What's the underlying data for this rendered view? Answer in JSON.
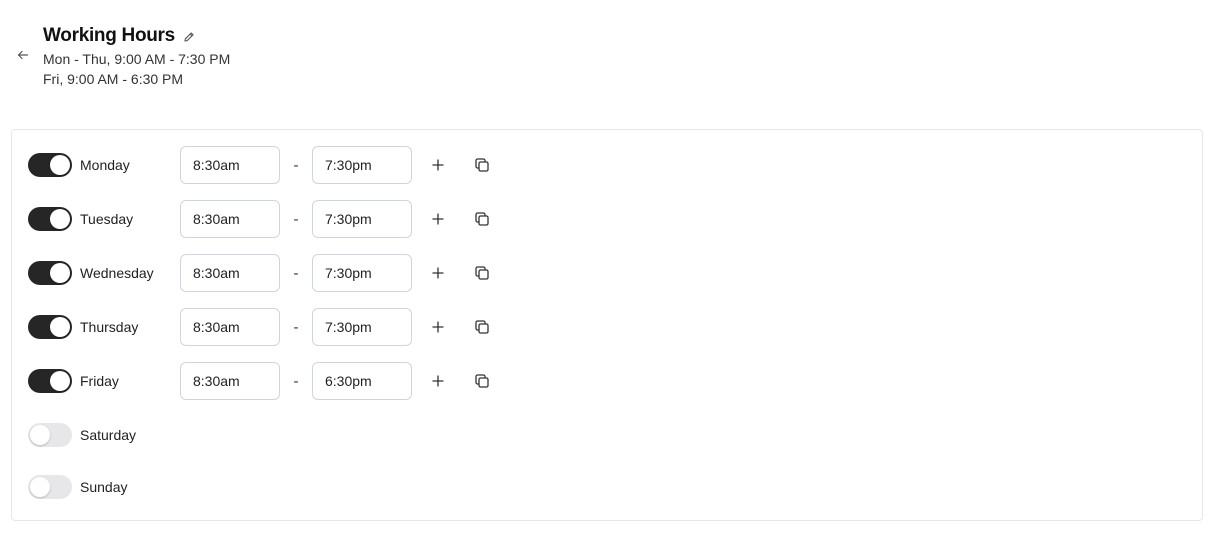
{
  "header": {
    "title": "Working Hours",
    "subtitle_lines": [
      "Mon - Thu, 9:00 AM - 7:30 PM",
      "Fri, 9:00 AM - 6:30 PM"
    ]
  },
  "schedule": {
    "separator": "-",
    "days": [
      {
        "label": "Monday",
        "enabled": true,
        "start": "8:30am",
        "end": "7:30pm"
      },
      {
        "label": "Tuesday",
        "enabled": true,
        "start": "8:30am",
        "end": "7:30pm"
      },
      {
        "label": "Wednesday",
        "enabled": true,
        "start": "8:30am",
        "end": "7:30pm"
      },
      {
        "label": "Thursday",
        "enabled": true,
        "start": "8:30am",
        "end": "7:30pm"
      },
      {
        "label": "Friday",
        "enabled": true,
        "start": "8:30am",
        "end": "6:30pm"
      },
      {
        "label": "Saturday",
        "enabled": false,
        "start": "",
        "end": ""
      },
      {
        "label": "Sunday",
        "enabled": false,
        "start": "",
        "end": ""
      }
    ]
  },
  "icons": {
    "back": "arrow-left-icon",
    "edit": "pencil-icon",
    "add": "plus-icon",
    "copy": "copy-icon"
  },
  "colors": {
    "toggle_on": "#262626",
    "toggle_off": "#e7e7ea",
    "border": "#e5e7eb"
  }
}
